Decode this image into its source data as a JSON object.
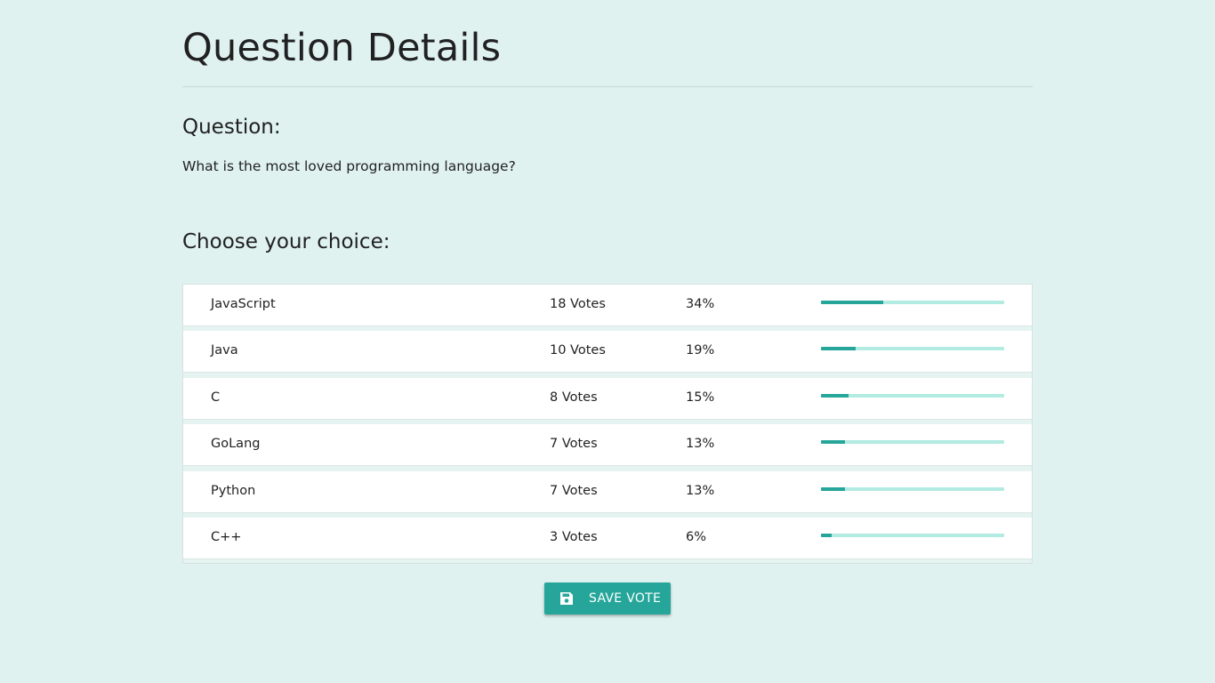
{
  "page": {
    "title": "Question Details"
  },
  "question": {
    "heading": "Question:",
    "text": "What is the most loved programming language?"
  },
  "choices": {
    "heading": "Choose your choice:",
    "items": [
      {
        "name": "JavaScript",
        "votes": "18 Votes",
        "percent": "34%",
        "fraction": 0.34
      },
      {
        "name": "Java",
        "votes": "10 Votes",
        "percent": "19%",
        "fraction": 0.19
      },
      {
        "name": "C",
        "votes": "8 Votes",
        "percent": "15%",
        "fraction": 0.15
      },
      {
        "name": "GoLang",
        "votes": "7 Votes",
        "percent": "13%",
        "fraction": 0.13
      },
      {
        "name": "Python",
        "votes": "7 Votes",
        "percent": "13%",
        "fraction": 0.13
      },
      {
        "name": "C++",
        "votes": "3 Votes",
        "percent": "6%",
        "fraction": 0.06
      }
    ]
  },
  "actions": {
    "save_label": "SAVE VOTE",
    "save_icon": "save-icon"
  },
  "colors": {
    "background": "#dff2f0",
    "accent": "#26a69a",
    "progress_track": "#b2ebe2"
  }
}
